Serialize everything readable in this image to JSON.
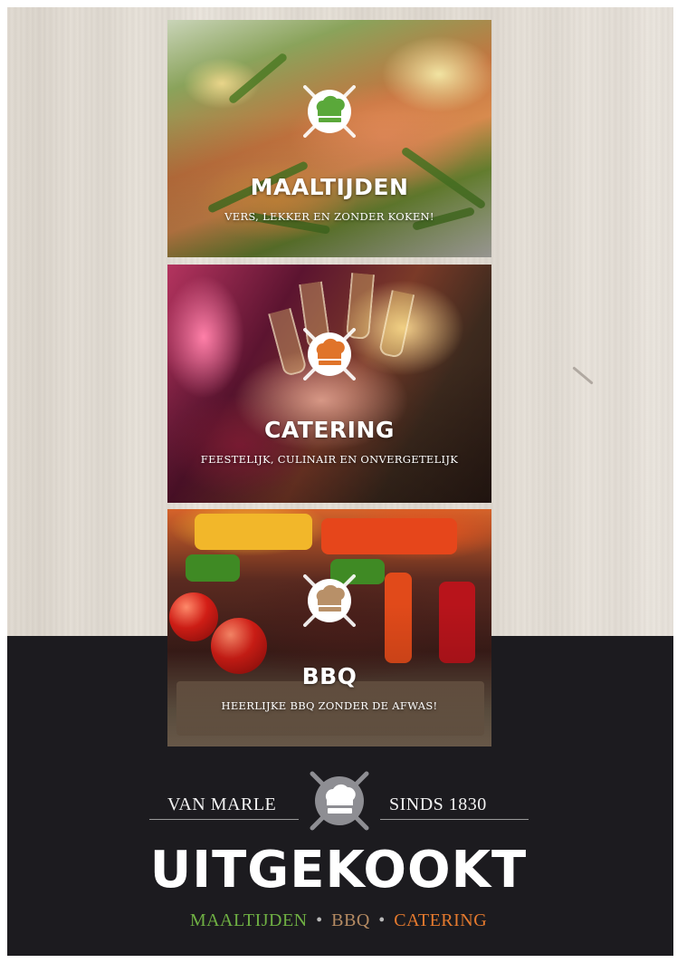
{
  "panels": [
    {
      "title": "MAALTIJDEN",
      "subtitle": "VERS, LEKKER EN ZONDER KOKEN!",
      "icon": "chef-hat-icon",
      "icon_color": "#5aa83a"
    },
    {
      "title": "CATERING",
      "subtitle": "FEESTELIJK, CULINAIR EN ONVERGETELIJK",
      "icon": "chef-hat-icon",
      "icon_color": "#e0742a"
    },
    {
      "title": "BBQ",
      "subtitle": "HEERLIJKE BBQ ZONDER DE AFWAS!",
      "icon": "chef-hat-icon",
      "icon_color": "#b89068"
    }
  ],
  "brand": {
    "left": "VAN MARLE",
    "right": "SINDS 1830",
    "name": "UITGEKOOKT",
    "services": [
      {
        "label": "MAALTIJDEN",
        "color": "#6fb043"
      },
      {
        "label": "BBQ",
        "color": "#b48a62"
      },
      {
        "label": "CATERING",
        "color": "#e57a2e"
      }
    ],
    "separator": "•"
  },
  "colors": {
    "dark_band": "#1c1b1f",
    "wood": "#e6e0d8"
  }
}
